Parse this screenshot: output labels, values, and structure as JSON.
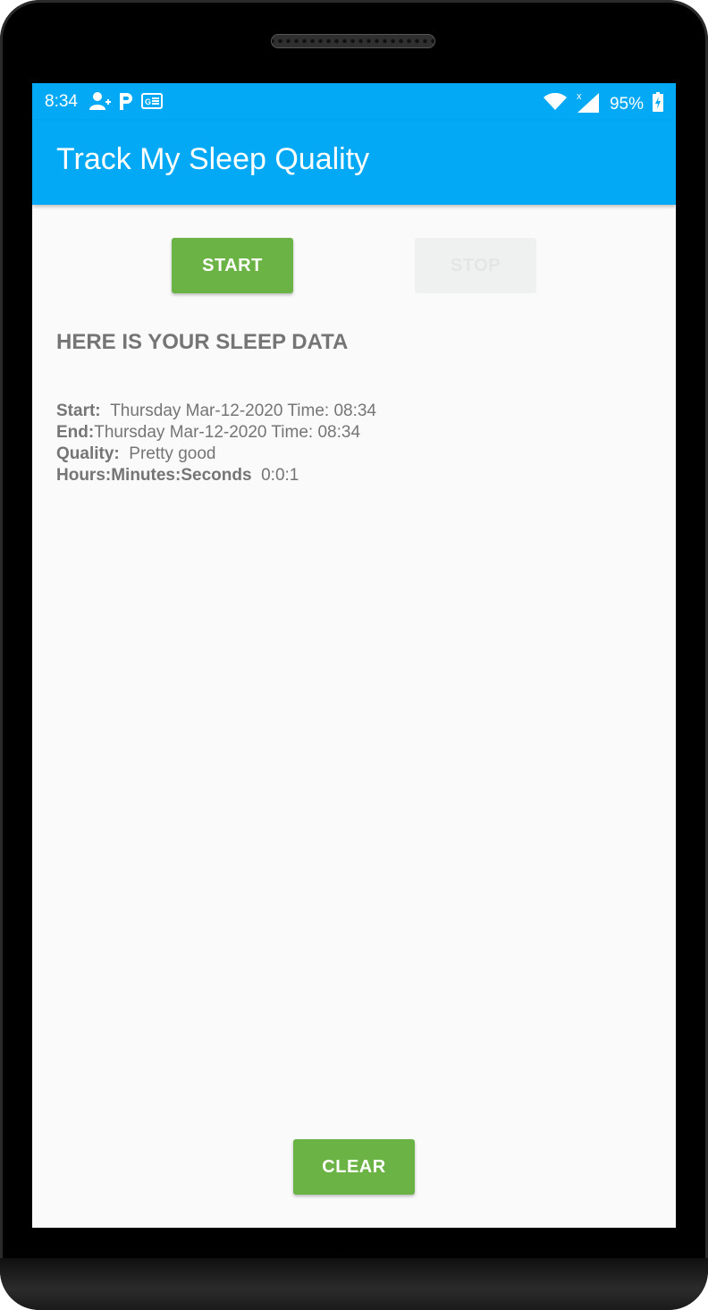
{
  "status_bar": {
    "time": "8:34",
    "battery_percent": "95%",
    "icons_left": [
      "person-add-icon",
      "p-icon",
      "ge-icon"
    ],
    "icons_right": [
      "wifi-icon",
      "signal-icon",
      "battery-charging-icon"
    ]
  },
  "app_bar": {
    "title": "Track My Sleep Quality",
    "color": "#03a9f4"
  },
  "buttons": {
    "start_label": "START",
    "stop_label": "STOP",
    "clear_label": "CLEAR",
    "accent": "#6ab344"
  },
  "sleep_data": {
    "heading": "HERE IS YOUR SLEEP DATA",
    "start_label": "Start:",
    "start_value": "Thursday Mar-12-2020 Time: 08:34",
    "end_label": "End:",
    "end_value": "Thursday Mar-12-2020 Time: 08:34",
    "quality_label": "Quality:",
    "quality_value": "Pretty good",
    "duration_label": "Hours:Minutes:Seconds",
    "duration_value": "0:0:1"
  }
}
